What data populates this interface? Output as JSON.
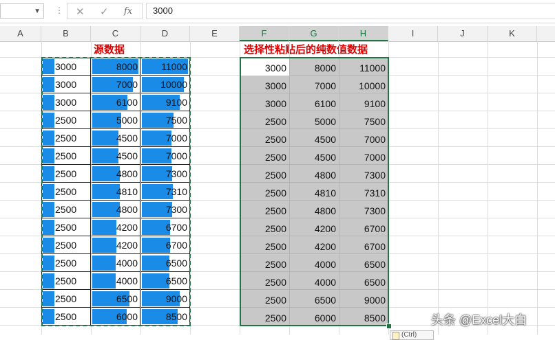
{
  "formula_bar": {
    "value": "3000",
    "fx_symbol": "fx"
  },
  "columns": [
    "A",
    "B",
    "C",
    "D",
    "E",
    "F",
    "G",
    "H",
    "I",
    "J",
    "K"
  ],
  "left_title": "源数据",
  "right_title": "选择性粘贴后的纯数值数据",
  "source": {
    "B": [
      3000,
      3000,
      3000,
      2500,
      2500,
      2500,
      2500,
      2500,
      2500,
      2500,
      2500,
      2500,
      2500,
      2500,
      2500
    ],
    "C": [
      8000,
      7000,
      6100,
      5000,
      4500,
      4500,
      4800,
      4810,
      4800,
      4200,
      4200,
      4000,
      4000,
      6500,
      6000
    ],
    "D": [
      11000,
      10000,
      9100,
      7500,
      7000,
      7000,
      7300,
      7310,
      7300,
      6700,
      6700,
      6500,
      6500,
      9000,
      8500
    ]
  },
  "pasted": {
    "F": [
      3000,
      3000,
      3000,
      2500,
      2500,
      2500,
      2500,
      2500,
      2500,
      2500,
      2500,
      2500,
      2500,
      2500,
      2500
    ],
    "G": [
      8000,
      7000,
      6100,
      5000,
      4500,
      4500,
      4800,
      4810,
      4800,
      4200,
      4200,
      4000,
      4000,
      6500,
      6000
    ],
    "H": [
      11000,
      10000,
      9100,
      7500,
      7000,
      7000,
      7300,
      7310,
      7300,
      6700,
      6700,
      6500,
      6500,
      9000,
      8500
    ]
  },
  "databar_color": "#1a8ce8",
  "selection_color": "#217346",
  "paste_options_label": "(Ctrl)",
  "watermark": "头条 @Excel大白"
}
